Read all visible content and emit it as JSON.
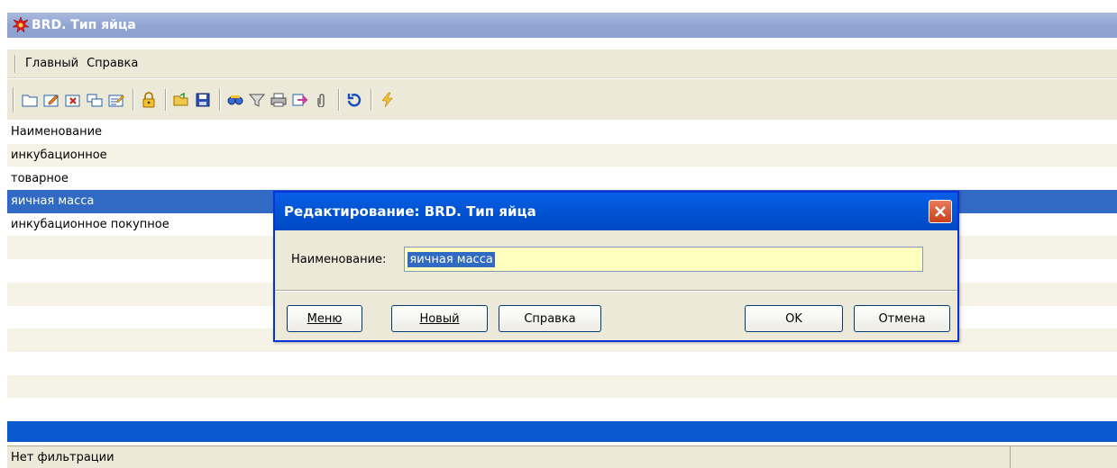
{
  "window": {
    "title": "BRD. Тип яйца",
    "icon": "star-burst-icon"
  },
  "menu": {
    "items": [
      "Главный",
      "Справка"
    ]
  },
  "toolbar": {
    "icons": [
      "new-folder-icon",
      "edit-icon",
      "delete-icon",
      "copy-icon",
      "edit-list-icon",
      "lock-icon",
      "open-folder-icon",
      "save-icon",
      "find-icon",
      "filter-icon",
      "print-icon",
      "export-icon",
      "attach-icon",
      "refresh-icon",
      "run-icon"
    ]
  },
  "grid": {
    "header": "Наименование",
    "rows": [
      "инкубационное",
      "товарное",
      "яичная масса",
      "инкубационное покупное"
    ],
    "selected_index": 2
  },
  "status": {
    "text": "Нет фильтрации"
  },
  "dialog": {
    "title": "Редактирование: BRD. Тип яйца",
    "field_label": "Наименование:",
    "field_value": "яичная масса",
    "buttons": {
      "menu": "Меню",
      "new": "Новый",
      "help": "Справка",
      "ok": "OK",
      "cancel": "Отмена"
    }
  },
  "colors": {
    "selection": "#316ac5",
    "dialog_title": "#0256d6",
    "input_bg": "#ffffc0",
    "statusbar_accent": "#0a58d0"
  }
}
